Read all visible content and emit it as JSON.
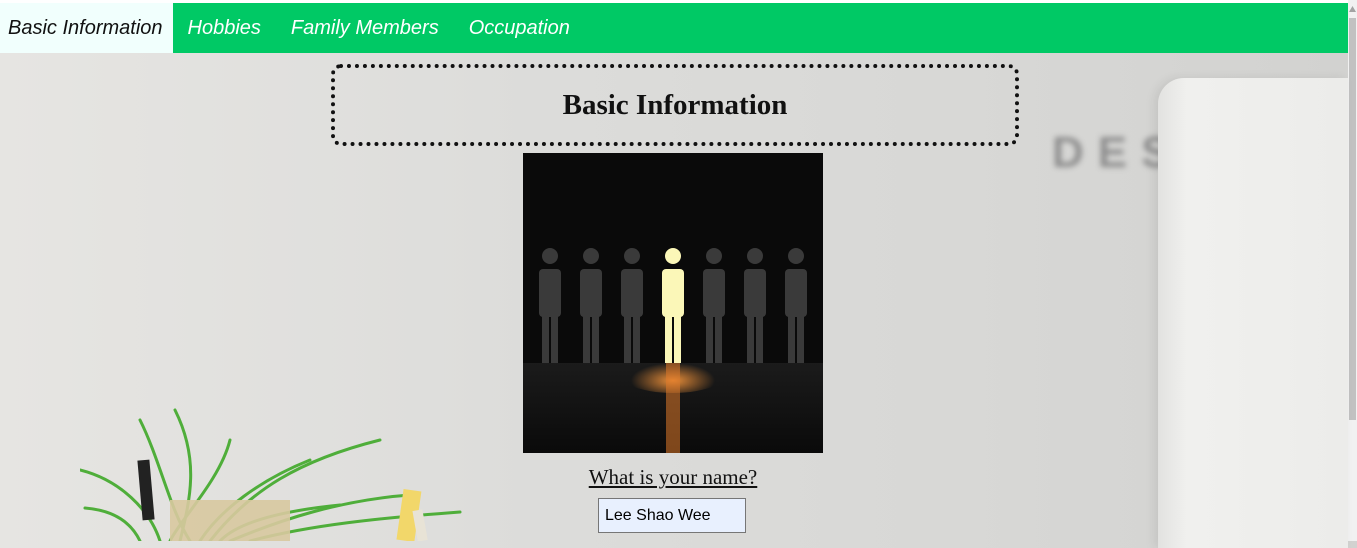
{
  "nav": {
    "items": [
      {
        "label": "Basic Information",
        "active": true
      },
      {
        "label": "Hobbies",
        "active": false
      },
      {
        "label": "Family Members",
        "active": false
      },
      {
        "label": "Occupation",
        "active": false
      }
    ]
  },
  "background": {
    "wall_text": "DES"
  },
  "main": {
    "heading": "Basic Information",
    "question": "What is your name?",
    "name_value": "Lee Shao Wee"
  },
  "colors": {
    "nav_bg": "#00c965",
    "nav_active_bg": "#f1fffd",
    "input_bg": "#e8f0fe"
  }
}
